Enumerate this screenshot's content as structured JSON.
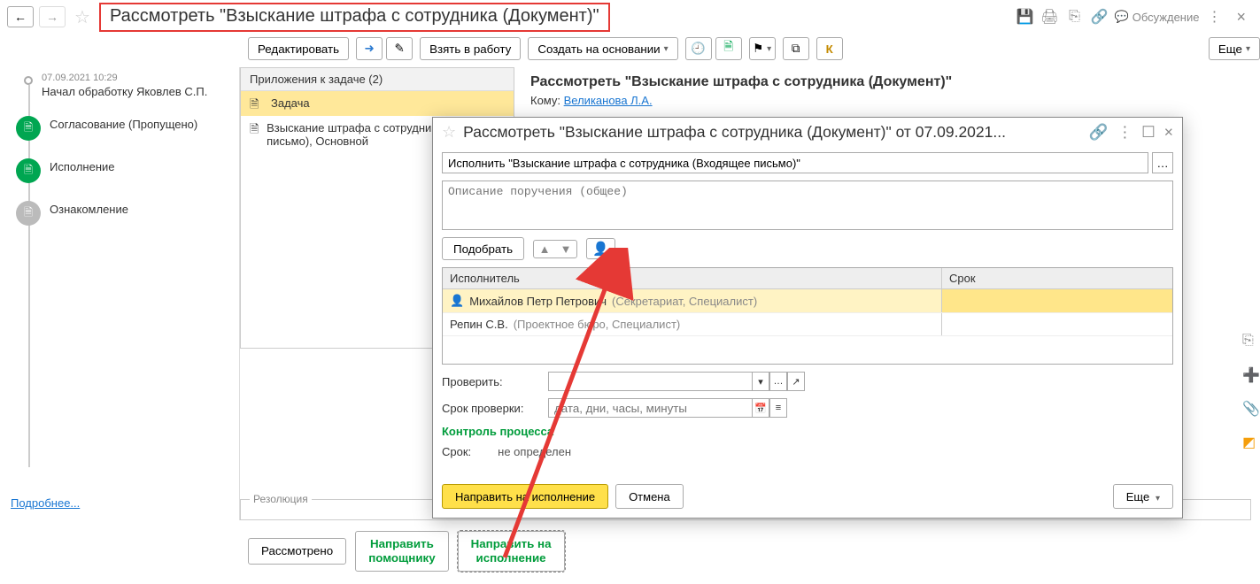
{
  "topbar": {
    "title": "Рассмотреть \"Взыскание штрафа с сотрудника (Документ)\"",
    "discuss": "Обсуждение"
  },
  "toolbar": {
    "edit": "Редактировать",
    "take": "Взять в работу",
    "create_based": "Создать на основании",
    "more": "Еще"
  },
  "history": {
    "items": [
      {
        "time": "07.09.2021 10:29",
        "text": "Начал обработку Яковлев С.П."
      },
      {
        "label": "Согласование (Пропущено)"
      },
      {
        "label": "Исполнение"
      },
      {
        "label": "Ознакомление"
      }
    ],
    "more": "Подробнее..."
  },
  "attachments": {
    "header": "Приложения к задаче (2)",
    "rows": [
      {
        "text": "Задача"
      },
      {
        "text": "Взыскание штрафа с сотрудника (Входящее письмо), Основной"
      }
    ]
  },
  "task": {
    "title": "Рассмотреть \"Взыскание штрафа с сотрудника (Документ)\"",
    "to_label": "Кому:",
    "to_name": "Великанова Л.А."
  },
  "resolution": {
    "label": "Резолюция"
  },
  "actions": {
    "done": "Рассмотрено",
    "to_assistant_l1": "Направить",
    "to_assistant_l2": "помощнику",
    "to_exec_l1": "Направить на",
    "to_exec_l2": "исполнение"
  },
  "modal": {
    "title": "Рассмотреть \"Взыскание штрафа с сотрудника (Документ)\" от 07.09.2021...",
    "exec_field": "Исполнить \"Взыскание штрафа с сотрудника (Входящее письмо)\"",
    "desc_placeholder": "Описание поручения (общее)",
    "select_btn": "Подобрать",
    "table": {
      "col_exec": "Исполнитель",
      "col_due": "Срок",
      "rows": [
        {
          "name": "Михайлов Петр Петрович",
          "role": "(Секретариат, Специалист)",
          "selected": true
        },
        {
          "name": "Репин С.В.",
          "role": "(Проектное бюро, Специалист)",
          "selected": false
        }
      ]
    },
    "check_label": "Проверить:",
    "due_check_label": "Срок проверки:",
    "due_check_placeholder": "дата, дни, часы, минуты",
    "control_process": "Контроль процесса",
    "proc_due_label": "Срок:",
    "proc_due_value": "не определен",
    "submit": "Направить на исполнение",
    "cancel": "Отмена",
    "more": "Еще"
  }
}
